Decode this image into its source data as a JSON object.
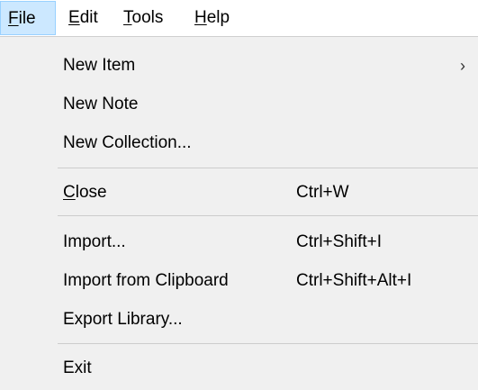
{
  "menubar": {
    "items": [
      {
        "mnemonic": "F",
        "rest": "ile",
        "active": true
      },
      {
        "mnemonic": "E",
        "rest": "dit",
        "active": false
      },
      {
        "mnemonic": "T",
        "rest": "ools",
        "active": false
      },
      {
        "mnemonic": "H",
        "rest": "elp",
        "active": false
      }
    ]
  },
  "file_menu": {
    "new_item": {
      "label": "New Item",
      "arrow": "›"
    },
    "new_note": {
      "label": "New Note"
    },
    "new_collection": {
      "label": "New Collection..."
    },
    "close": {
      "mnemonic": "C",
      "rest": "lose",
      "shortcut": "Ctrl+W"
    },
    "import": {
      "label": "Import...",
      "shortcut": "Ctrl+Shift+I"
    },
    "import_clipboard": {
      "label": "Import from Clipboard",
      "shortcut": "Ctrl+Shift+Alt+I"
    },
    "export_library": {
      "label": "Export Library..."
    },
    "exit": {
      "label": "Exit"
    }
  },
  "colors": {
    "menubar_active_bg": "#cce8ff",
    "menubar_active_border": "#99d1ff",
    "dropdown_bg": "#f0f0f0",
    "separator": "#cccccc"
  }
}
